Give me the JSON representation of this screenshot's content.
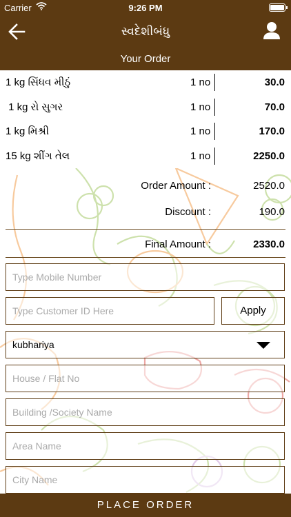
{
  "status_bar": {
    "carrier": "Carrier",
    "time": "9:26 PM"
  },
  "nav": {
    "title": "સ્વદેશીબંધુ"
  },
  "order": {
    "header": "Your Order",
    "items": [
      {
        "name": "1 kg સિંધવ મીઠું",
        "qty": "1 no",
        "price": "30.0"
      },
      {
        "name": " 1 kg રો સુગર",
        "qty": "1 no",
        "price": "70.0"
      },
      {
        "name": "1 kg મિશ્રી",
        "qty": "1 no",
        "price": "170.0"
      },
      {
        "name": "15 kg શીંગ તેલ",
        "qty": "1 no",
        "price": "2250.0"
      }
    ]
  },
  "summary": {
    "order_amount_label": "Order Amount :",
    "order_amount": "2520.0",
    "discount_label": "Discount :",
    "discount": "190.0",
    "final_amount_label": "Final Amount :",
    "final_amount": "2330.0"
  },
  "form": {
    "mobile_placeholder": "Type Mobile Number",
    "customer_id_placeholder": "Type Customer ID Here",
    "apply_label": "Apply",
    "area_select_value": "kubhariya",
    "house_placeholder": "House / Flat No",
    "building_placeholder": "Building /Society Name",
    "area_placeholder": "Area Name",
    "city_placeholder": "City Name"
  },
  "footer": {
    "place_order_label": "PLACE ORDER"
  },
  "colors": {
    "brand": "#5c3a12"
  }
}
